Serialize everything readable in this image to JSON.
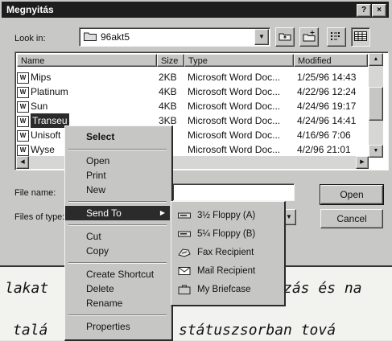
{
  "window": {
    "title": "Megnyitás",
    "help_label": "?",
    "close_label": "×"
  },
  "lookin": {
    "label": "Look in:",
    "value": "96akt5"
  },
  "list": {
    "columns": [
      "Name",
      "Size",
      "Type",
      "Modified"
    ],
    "rows": [
      {
        "name": "Mips",
        "size": "2KB",
        "type": "Microsoft Word Doc...",
        "modified": "1/25/96 14:43"
      },
      {
        "name": "Platinum",
        "size": "4KB",
        "type": "Microsoft Word Doc...",
        "modified": "4/22/96 12:24"
      },
      {
        "name": "Sun",
        "size": "4KB",
        "type": "Microsoft Word Doc...",
        "modified": "4/24/96 19:17"
      },
      {
        "name": "Transeu",
        "size": "3KB",
        "type": "Microsoft Word Doc...",
        "modified": "4/24/96 14:41"
      },
      {
        "name": "Unisoft",
        "size": "",
        "type": "Microsoft Word Doc...",
        "modified": "4/16/96 7:06"
      },
      {
        "name": "Wyse",
        "size": "",
        "type": "Microsoft Word Doc...",
        "modified": "4/2/96 21:01"
      }
    ]
  },
  "form": {
    "file_name_label": "File name:",
    "files_of_type_label": "Files of type:",
    "open_label": "Open",
    "cancel_label": "Cancel"
  },
  "context_menu": {
    "items": [
      "Select",
      "Open",
      "Print",
      "New",
      "Send To",
      "Cut",
      "Copy",
      "Create Shortcut",
      "Delete",
      "Rename",
      "Properties"
    ]
  },
  "send_to": {
    "items": [
      "3½ Floppy (A)",
      "5¼ Floppy (B)",
      "Fax Recipient",
      "Mail Recipient",
      "My Briefcase"
    ]
  },
  "background_text": {
    "line1_left": "lakat",
    "line1_right": "zás és na",
    "line2_left": "talá",
    "line2_right": "státuszsorban tová"
  }
}
